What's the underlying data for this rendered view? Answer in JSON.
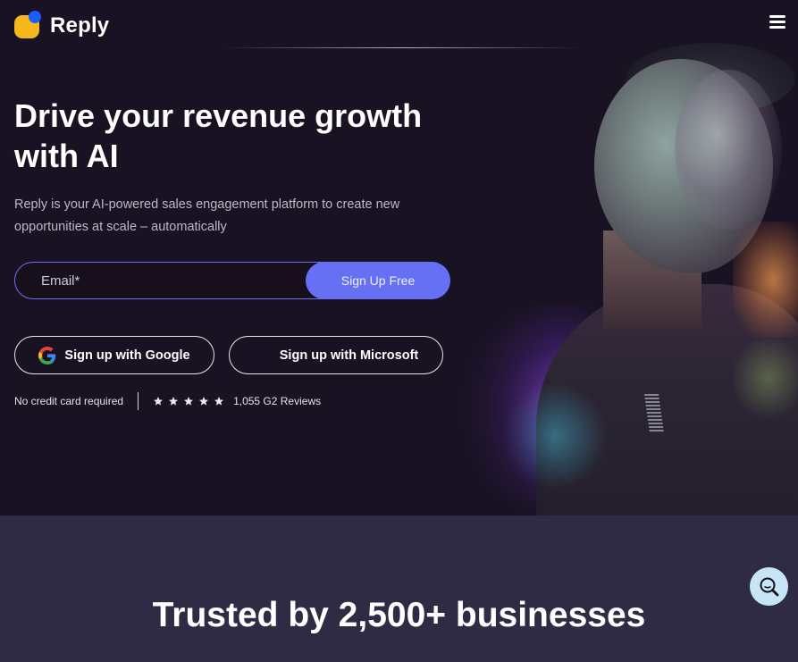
{
  "nav": {
    "brand": "Reply",
    "menu_icon": "hamburger-menu-icon"
  },
  "hero": {
    "headline": "Drive your revenue growth with AI",
    "subtext": "Reply is your AI-powered sales engagement platform to create new opportunities at scale – automatically",
    "form": {
      "email_placeholder": "Email*",
      "email_value": "",
      "submit_label": "Sign Up Free"
    },
    "sso": [
      {
        "label": "Sign up with Google",
        "icon": "google-icon"
      },
      {
        "label": "Sign up with Microsoft",
        "icon": "microsoft-icon"
      }
    ],
    "trust": {
      "no_card": "No credit card required",
      "rating_stars": 5,
      "reviews": "1,055 G2 Reviews"
    }
  },
  "trusted": {
    "title": "Trusted by 2,500+ businesses"
  },
  "fab": {
    "icon": "search-icon"
  },
  "colors": {
    "hero_bg": "#191223",
    "accent": "#6670f5",
    "logo_yellow": "#f7b81c",
    "logo_blue": "#1a5cff",
    "section_bg": "#302b44",
    "fab_bg": "#c6e6f7"
  }
}
